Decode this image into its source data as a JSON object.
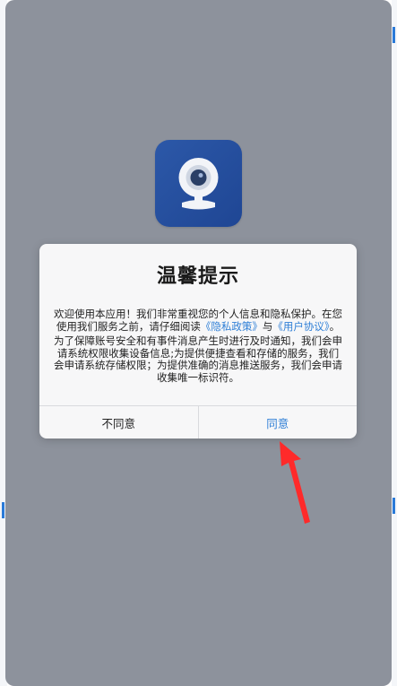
{
  "dialog": {
    "title": "温馨提示",
    "body_p1_a": "欢迎使用本应用！我们非常重视您的个人信息和隐私保护。在您使用我们服务之前，请仔细阅读",
    "privacy_link": "《隐私政策》",
    "body_p1_and": "与",
    "terms_link": "《用户协议》",
    "body_p1_end": "。",
    "body_p2": "为了保障账号安全和有事件消息产生时进行及时通知，我们会申请系统权限收集设备信息;为提供便捷查看和存储的服务，我们会申请系统存储权限；为提供准确的消息推送服务，我们会申请收集唯一标识符。",
    "disagree_label": "不同意",
    "agree_label": "同意"
  },
  "colors": {
    "accent": "#2f7fd6",
    "overlay": "#8d929c",
    "app_icon": "#2c58a8",
    "arrow": "#ff2a2a"
  },
  "icons": {
    "app": "webcam-icon",
    "annotation": "red-arrow-icon"
  }
}
